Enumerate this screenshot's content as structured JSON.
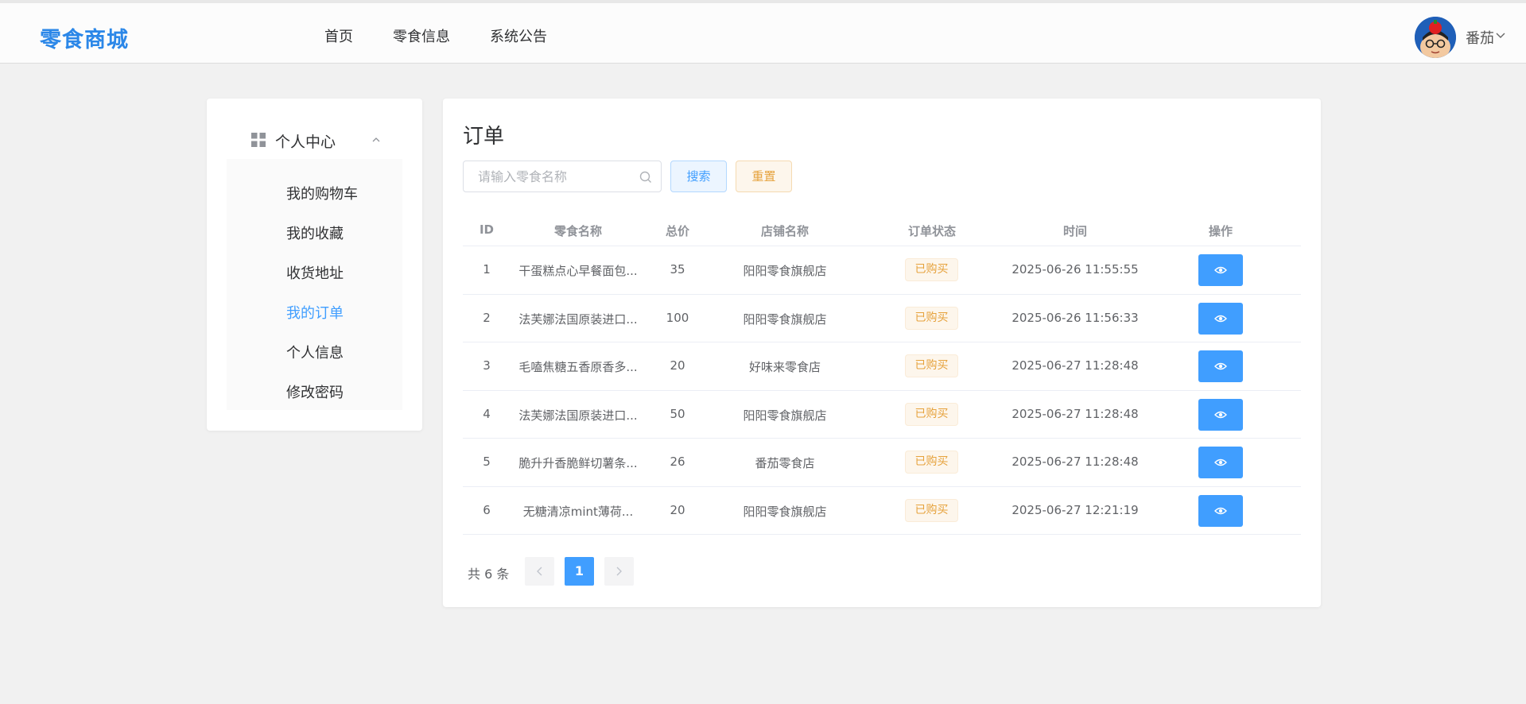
{
  "header": {
    "logo": "零食商城",
    "nav": [
      "首页",
      "零食信息",
      "系统公告"
    ],
    "user_name": "番茄"
  },
  "sidebar": {
    "title": "个人中心",
    "items": [
      {
        "label": "我的购物车",
        "active": false
      },
      {
        "label": "我的收藏",
        "active": false
      },
      {
        "label": "收货地址",
        "active": false
      },
      {
        "label": "我的订单",
        "active": true
      },
      {
        "label": "个人信息",
        "active": false
      },
      {
        "label": "修改密码",
        "active": false
      }
    ]
  },
  "main": {
    "title": "订单",
    "search": {
      "placeholder": "请输入零食名称",
      "value": ""
    },
    "search_button": "搜索",
    "reset_button": "重置",
    "columns": [
      "ID",
      "零食名称",
      "总价",
      "店铺名称",
      "订单状态",
      "时间",
      "操作"
    ],
    "rows": [
      {
        "id": "1",
        "name": "干蛋糕点心早餐面包...",
        "total": "35",
        "shop": "阳阳零食旗舰店",
        "status": "已购买",
        "time": "2025-06-26 11:55:55"
      },
      {
        "id": "2",
        "name": "法芙娜法国原装进口...",
        "total": "100",
        "shop": "阳阳零食旗舰店",
        "status": "已购买",
        "time": "2025-06-26 11:56:33"
      },
      {
        "id": "3",
        "name": "毛嗑焦糖五香原香多...",
        "total": "20",
        "shop": "好味来零食店",
        "status": "已购买",
        "time": "2025-06-27 11:28:48"
      },
      {
        "id": "4",
        "name": "法芙娜法国原装进口...",
        "total": "50",
        "shop": "阳阳零食旗舰店",
        "status": "已购买",
        "time": "2025-06-27 11:28:48"
      },
      {
        "id": "5",
        "name": "脆升升香脆鲜切薯条...",
        "total": "26",
        "shop": "番茄零食店",
        "status": "已购买",
        "time": "2025-06-27 11:28:48"
      },
      {
        "id": "6",
        "name": "无糖清凉mint薄荷...",
        "total": "20",
        "shop": "阳阳零食旗舰店",
        "status": "已购买",
        "time": "2025-06-27 12:21:19"
      }
    ],
    "pagination": {
      "total_text": "共 6 条",
      "current_page": "1"
    }
  }
}
